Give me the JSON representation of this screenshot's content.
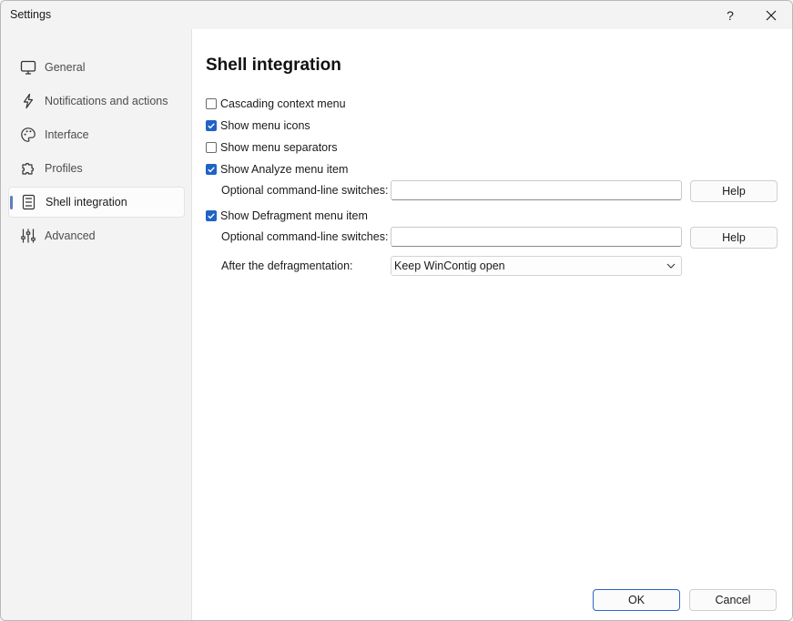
{
  "window": {
    "title": "Settings",
    "help_glyph": "?",
    "close_glyph": "✕"
  },
  "sidebar": {
    "items": [
      {
        "label": "General",
        "icon": "monitor-icon"
      },
      {
        "label": "Notifications and actions",
        "icon": "lightning-icon"
      },
      {
        "label": "Interface",
        "icon": "palette-icon"
      },
      {
        "label": "Profiles",
        "icon": "puzzle-icon"
      },
      {
        "label": "Shell integration",
        "icon": "context-menu-icon",
        "active": true
      },
      {
        "label": "Advanced",
        "icon": "sliders-icon"
      }
    ]
  },
  "main": {
    "title": "Shell integration",
    "options": {
      "cascading": {
        "label": "Cascading context menu",
        "checked": false
      },
      "menu_icons": {
        "label": "Show menu icons",
        "checked": true
      },
      "menu_separators": {
        "label": "Show menu separators",
        "checked": false
      },
      "analyze_item": {
        "label": "Show Analyze menu item",
        "checked": true
      },
      "defragment_item": {
        "label": "Show Defragment menu item",
        "checked": true
      }
    },
    "analyze_switches": {
      "label": "Optional command-line switches:",
      "value": "",
      "help_label": "Help"
    },
    "defrag_switches": {
      "label": "Optional command-line switches:",
      "value": "",
      "help_label": "Help"
    },
    "after_defrag": {
      "label": "After the defragmentation:",
      "selected": "Keep WinContig open"
    }
  },
  "footer": {
    "ok_label": "OK",
    "cancel_label": "Cancel"
  },
  "colors": {
    "accent": "#1f63c7",
    "active_indicator": "#5b7fbf"
  }
}
